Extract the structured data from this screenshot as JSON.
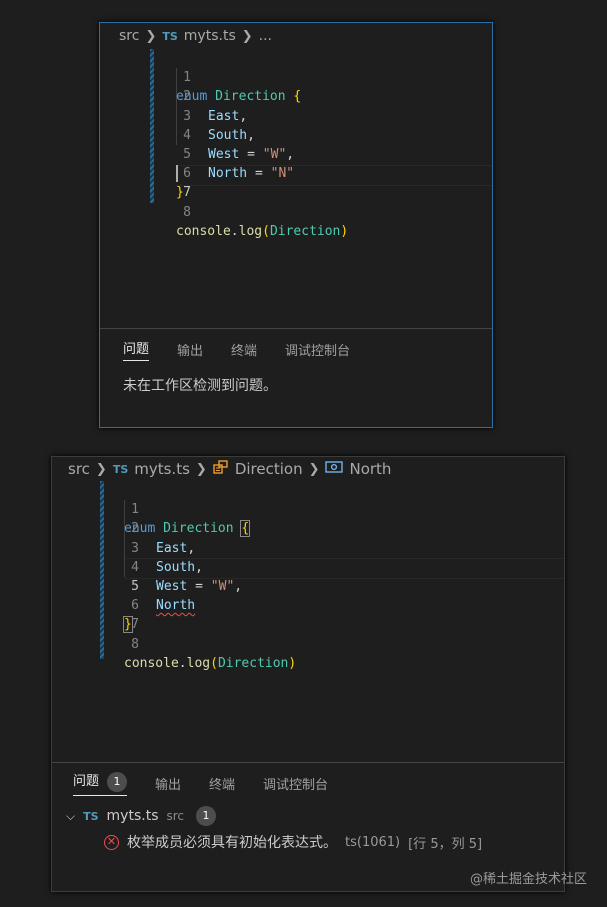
{
  "window1": {
    "breadcrumb": {
      "folder": "src",
      "file_badge": "TS",
      "file": "myts.ts",
      "more": "..."
    },
    "lines": [
      {
        "n": "1"
      },
      {
        "n": "2"
      },
      {
        "n": "3"
      },
      {
        "n": "4"
      },
      {
        "n": "5"
      },
      {
        "n": "6"
      },
      {
        "n": "7"
      },
      {
        "n": "8"
      }
    ],
    "code": {
      "enum_kw": "enum",
      "enum_name": "Direction",
      "open_brace": "{",
      "m1": "East",
      "m2": "South",
      "m3": "West",
      "m3_val": "\"W\"",
      "m4": "North",
      "m4_val": "\"N\"",
      "close_brace": "}",
      "console": "console",
      "log": "log",
      "arg": "Direction"
    },
    "panel": {
      "tabs": [
        "问题",
        "输出",
        "终端",
        "调试控制台"
      ],
      "message": "未在工作区检测到问题。"
    }
  },
  "window2": {
    "breadcrumb": {
      "folder": "src",
      "file_badge": "TS",
      "file": "myts.ts",
      "symbol1": "Direction",
      "symbol2": "North"
    },
    "lines": [
      {
        "n": "1"
      },
      {
        "n": "2"
      },
      {
        "n": "3"
      },
      {
        "n": "4"
      },
      {
        "n": "5"
      },
      {
        "n": "6"
      },
      {
        "n": "7"
      },
      {
        "n": "8"
      }
    ],
    "code": {
      "enum_kw": "enum",
      "enum_name": "Direction",
      "open_brace": "{",
      "m1": "East",
      "m2": "South",
      "m3": "West",
      "m3_val": "\"W\"",
      "m4": "North",
      "close_brace": "}",
      "console": "console",
      "log": "log",
      "arg": "Direction"
    },
    "panel": {
      "tabs": [
        "问题",
        "输出",
        "终端",
        "调试控制台"
      ],
      "problem_count": "1",
      "file_badge": "TS",
      "file": "myts.ts",
      "folder": "src",
      "file_count": "1",
      "error_message": "枚举成员必须具有初始化表达式。",
      "error_code": "ts(1061)",
      "error_location": "[行 5，列 5]"
    }
  },
  "watermark": "@稀土掘金技术社区"
}
